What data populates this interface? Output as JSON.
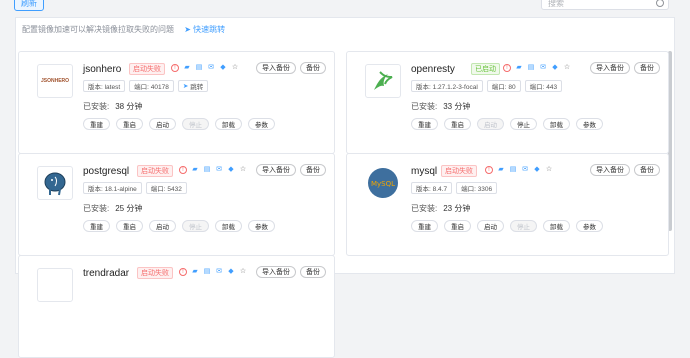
{
  "toolbar": {
    "refresh_label": "刷新",
    "search_placeholder": "搜索"
  },
  "tip": {
    "text": "配置镜像加速可以解决镜像拉取失败的问题",
    "link": "快速跳转"
  },
  "common": {
    "import_backup": "导入备份",
    "backup": "备份",
    "installed_label": "已安装:"
  },
  "buttons": [
    "重建",
    "重启",
    "启动",
    "停止",
    "卸载",
    "参数"
  ],
  "apps": [
    {
      "name": "jsonhero",
      "status": "启动失败",
      "status_type": "bad",
      "version": "版本: latest",
      "port1": "端口: 40178",
      "extra": "跳转",
      "installed": "38 分钟",
      "logo_text": "JSONHERO",
      "disabled": "停止"
    },
    {
      "name": "openresty",
      "status": "已启动",
      "status_type": "ok",
      "version": "版本: 1.27.1.2-3-focal",
      "port1": "端口: 80",
      "port2": "端口: 443",
      "installed": "33 分钟",
      "disabled": "启动"
    },
    {
      "name": "postgresql",
      "status": "启动失败",
      "status_type": "bad",
      "version": "版本: 18.1-alpine",
      "port1": "端口: 5432",
      "installed": "25 分钟",
      "disabled": "停止"
    },
    {
      "name": "mysql",
      "status": "启动失败",
      "status_type": "bad",
      "version": "版本: 8.4.7",
      "port1": "端口: 3306",
      "installed": "23 分钟",
      "logo_text": "MySQL",
      "disabled": "停止"
    },
    {
      "name": "trendradar",
      "status": "启动失败",
      "status_type": "bad"
    }
  ]
}
